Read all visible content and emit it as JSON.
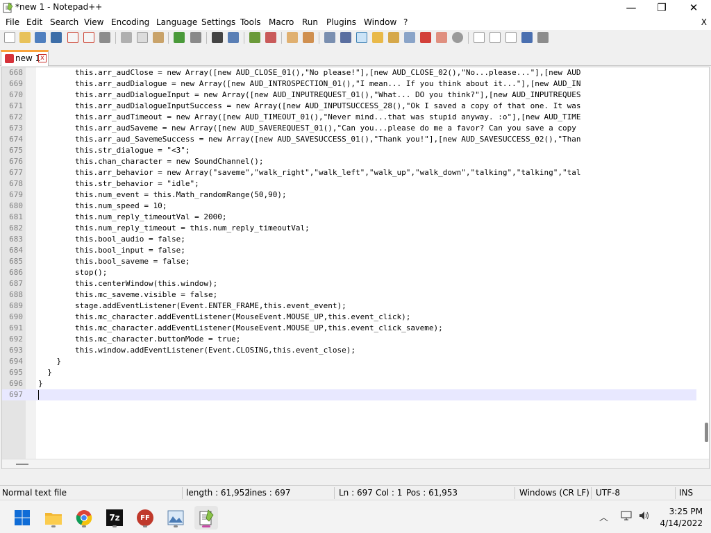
{
  "window": {
    "title": "*new 1 - Notepad++",
    "minimize_glyph": "—",
    "maximize_glyph": "❐",
    "close_glyph": "✕"
  },
  "menubar": {
    "items": [
      "File",
      "Edit",
      "Search",
      "View",
      "Encoding",
      "Language",
      "Settings",
      "Tools",
      "Macro",
      "Run",
      "Plugins",
      "Window",
      "?"
    ],
    "close_label": "X"
  },
  "toolbar": {
    "icons": [
      "new-file-icon",
      "open-file-icon",
      "save-icon",
      "save-all-icon",
      "close-icon",
      "close-all-icon",
      "print-icon",
      "cut-icon",
      "copy-icon",
      "paste-icon",
      "undo-icon",
      "redo-icon",
      "find-icon",
      "replace-icon",
      "zoom-in-icon",
      "zoom-out-icon",
      "sync-vertical-icon",
      "sync-horizontal-icon",
      "word-wrap-icon",
      "show-all-chars-icon",
      "indent-guide-icon",
      "user-language-icon",
      "document-map-icon",
      "function-list-icon",
      "folder-workspace-icon",
      "monitoring-icon",
      "record-macro-icon",
      "stop-macro-icon",
      "play-macro-icon",
      "run-macro-icon",
      "save-macro-icon"
    ]
  },
  "tab": {
    "label": "new 1",
    "close_glyph": "x"
  },
  "editor": {
    "lines": [
      {
        "num": "668",
        "text": "        this.arr_audClose = new Array([new AUD_CLOSE_01(),\"No please!\"],[new AUD_CLOSE_02(),\"No...please...\"],[new AUD"
      },
      {
        "num": "669",
        "text": "        this.arr_audDialogue = new Array([new AUD_INTROSPECTION_01(),\"I mean... If you think about it...\"],[new AUD_IN"
      },
      {
        "num": "670",
        "text": "        this.arr_audDialogueInput = new Array([new AUD_INPUTREQUEST_01(),\"What... DO you think?\"],[new AUD_INPUTREQUES"
      },
      {
        "num": "671",
        "text": "        this.arr_audDialogueInputSuccess = new Array([new AUD_INPUTSUCCESS_28(),\"Ok I saved a copy of that one. It was"
      },
      {
        "num": "672",
        "text": "        this.arr_audTimeout = new Array([new AUD_TIMEOUT_01(),\"Never mind...that was stupid anyway. :o\"],[new AUD_TIME"
      },
      {
        "num": "673",
        "text": "        this.arr_audSaveme = new Array([new AUD_SAVEREQUEST_01(),\"Can you...please do me a favor? Can you save a copy"
      },
      {
        "num": "674",
        "text": "        this.arr_aud_SavemeSuccess = new Array([new AUD_SAVESUCCESS_01(),\"Thank you!\"],[new AUD_SAVESUCCESS_02(),\"Than"
      },
      {
        "num": "675",
        "text": "        this.str_dialogue = \"<3\";"
      },
      {
        "num": "676",
        "text": "        this.chan_character = new SoundChannel();"
      },
      {
        "num": "677",
        "text": "        this.arr_behavior = new Array(\"saveme\",\"walk_right\",\"walk_left\",\"walk_up\",\"walk_down\",\"talking\",\"talking\",\"tal"
      },
      {
        "num": "678",
        "text": "        this.str_behavior = \"idle\";"
      },
      {
        "num": "679",
        "text": "        this.num_event = this.Math_randomRange(50,90);"
      },
      {
        "num": "680",
        "text": "        this.num_speed = 10;"
      },
      {
        "num": "681",
        "text": "        this.num_reply_timeoutVal = 2000;"
      },
      {
        "num": "682",
        "text": "        this.num_reply_timeout = this.num_reply_timeoutVal;"
      },
      {
        "num": "683",
        "text": "        this.bool_audio = false;"
      },
      {
        "num": "684",
        "text": "        this.bool_input = false;"
      },
      {
        "num": "685",
        "text": "        this.bool_saveme = false;"
      },
      {
        "num": "686",
        "text": "        stop();"
      },
      {
        "num": "687",
        "text": "        this.centerWindow(this.window);"
      },
      {
        "num": "688",
        "text": "        this.mc_saveme.visible = false;"
      },
      {
        "num": "689",
        "text": "        stage.addEventListener(Event.ENTER_FRAME,this.event_event);"
      },
      {
        "num": "690",
        "text": "        this.mc_character.addEventListener(MouseEvent.MOUSE_UP,this.event_click);"
      },
      {
        "num": "691",
        "text": "        this.mc_character.addEventListener(MouseEvent.MOUSE_UP,this.event_click_saveme);"
      },
      {
        "num": "692",
        "text": "        this.mc_character.buttonMode = true;"
      },
      {
        "num": "693",
        "text": "        this.window.addEventListener(Event.CLOSING,this.event_close);"
      },
      {
        "num": "694",
        "text": "    }"
      },
      {
        "num": "695",
        "text": "  }"
      },
      {
        "num": "696",
        "text": "}"
      },
      {
        "num": "697",
        "text": ""
      }
    ],
    "current_line": "697"
  },
  "statusbar": {
    "file_type": "Normal text file",
    "length": "length : 61,952",
    "lines": "lines : 697",
    "ln": "Ln : 697",
    "col": "Col : 1",
    "pos": "Pos : 61,953",
    "eol": "Windows (CR LF)",
    "encoding": "UTF-8",
    "mode": "INS"
  },
  "taskbar": {
    "apps": [
      "start-icon",
      "file-explorer-icon",
      "chrome-icon",
      "7zip-icon",
      "ffdec-icon",
      "photos-icon",
      "notepadpp-icon"
    ],
    "sevenzip_label": "7z",
    "ffdec_label": "FF",
    "tray_chevron": "︿",
    "time": "3:25 PM",
    "date": "4/14/2022"
  },
  "colors": {
    "tab_accent": "#f9a23a",
    "current_line": "#e8e8ff",
    "gutter": "#e4e4e4"
  }
}
